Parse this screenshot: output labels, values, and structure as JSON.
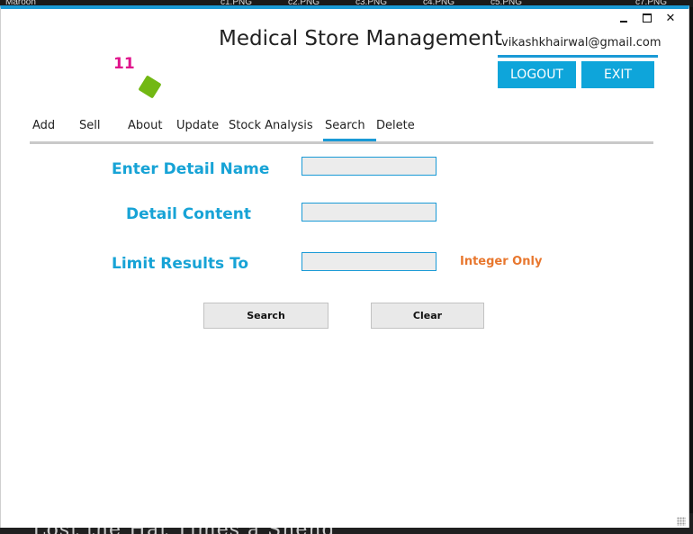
{
  "app": {
    "title": "Medical Store Management",
    "user_email": "vikashkhairwal@gmail.com",
    "counter": "11",
    "accent_color": "#1a9ad6",
    "button_color": "#0ea5da",
    "label_color": "#17a3d6"
  },
  "desktop": {
    "top_items": [
      "Maroon",
      "c1.PNG",
      "c2.PNG",
      "c3.PNG",
      "c4.PNG",
      "c5.PNG",
      "c7.PNG"
    ],
    "bottom_text": "Lost the Hat Times a Sheng"
  },
  "window_controls": {
    "minimize_icon": "minimize-icon",
    "maximize_icon": "maximize-icon",
    "close_label": "✕"
  },
  "header": {
    "logout_label": "LOGOUT",
    "exit_label": "EXIT"
  },
  "tabs": [
    {
      "label": "Add"
    },
    {
      "label": "Sell"
    },
    {
      "label": "About"
    },
    {
      "label": "Update"
    },
    {
      "label": "Stock Analysis"
    },
    {
      "label": "Search",
      "active": true
    },
    {
      "label": "Delete"
    }
  ],
  "form": {
    "detail_name_label": "Enter Detail Name",
    "detail_name_value": "",
    "detail_content_label": "Detail Content",
    "detail_content_value": "",
    "limit_label": "Limit Results To",
    "limit_value": "",
    "limit_hint": "Integer Only",
    "search_label": "Search",
    "clear_label": "Clear"
  }
}
